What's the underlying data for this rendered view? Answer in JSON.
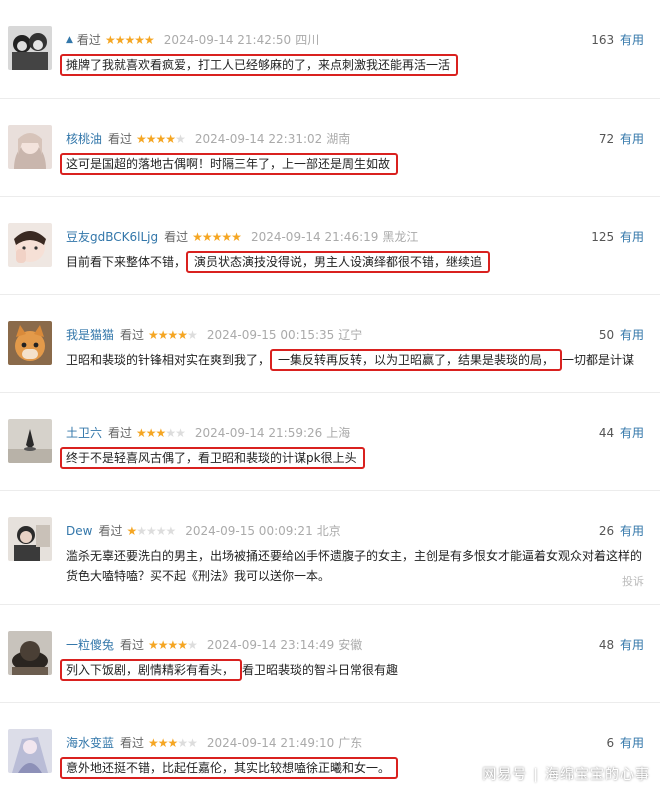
{
  "common": {
    "seen_label": "看过",
    "useful_label": "有用",
    "report_label": "投诉"
  },
  "comments": [
    {
      "username": "",
      "rating": 5,
      "time": "2024-09-14 21:42:50",
      "location": "四川",
      "useful": "163",
      "pre": "",
      "highlight": "摊牌了我就喜欢看疯爱，打工人已经够麻的了，来点刺激我还能再活一活",
      "post": ""
    },
    {
      "username": "核桃油",
      "rating": 4,
      "time": "2024-09-14 22:31:02",
      "location": "湖南",
      "useful": "72",
      "pre": "",
      "highlight": "这可是国超的落地古偶啊！时隔三年了，上一部还是周生如故",
      "post": ""
    },
    {
      "username": "豆友gdBCK6lLjg",
      "rating": 5,
      "time": "2024-09-14 21:46:19",
      "location": "黑龙江",
      "useful": "125",
      "pre": "目前看下来整体不错，",
      "highlight": "演员状态演技没得说，男主人设演绎都很不错，继续追",
      "post": ""
    },
    {
      "username": "我是猫猫",
      "rating": 4,
      "time": "2024-09-15 00:15:35",
      "location": "辽宁",
      "useful": "50",
      "pre": "卫昭和裴琰的针锋相对实在爽到我了，",
      "highlight": "一集反转再反转，以为卫昭赢了，结果是裴琰的局，",
      "post": "一切都是计谋"
    },
    {
      "username": "土卫六",
      "rating": 3,
      "time": "2024-09-14 21:59:26",
      "location": "上海",
      "useful": "44",
      "pre": "",
      "highlight": "终于不是轻喜风古偶了，看卫昭和裴琰的计谋pk很上头",
      "post": ""
    },
    {
      "username": "Dew",
      "rating": 1,
      "time": "2024-09-15 00:09:21",
      "location": "北京",
      "useful": "26",
      "pre": "滥杀无辜还要洗白的男主，出场被捅还要给凶手怀遗腹子的女主，主创是有多恨女才能逼着女观众对着这样的货色大嗑特嗑？买不起《刑法》我可以送你一本。",
      "highlight": "",
      "post": "",
      "report": true
    },
    {
      "username": "一粒傻兔",
      "rating": 4,
      "time": "2024-09-14 23:14:49",
      "location": "安徽",
      "useful": "48",
      "pre": "",
      "highlight": "列入下饭剧，剧情精彩有看头，",
      "post": "看卫昭裴琰的智斗日常很有趣"
    },
    {
      "username": "海水变蓝",
      "rating": 3,
      "time": "2024-09-14 21:49:10",
      "location": "广东",
      "useful": "6",
      "pre": "",
      "highlight": "意外地还挺不错，比起任嘉伦，其实比较想嗑徐正曦和女一。",
      "post": ""
    }
  ],
  "watermark": {
    "platform": "网易号",
    "author": "海绵宝宝的心事"
  }
}
